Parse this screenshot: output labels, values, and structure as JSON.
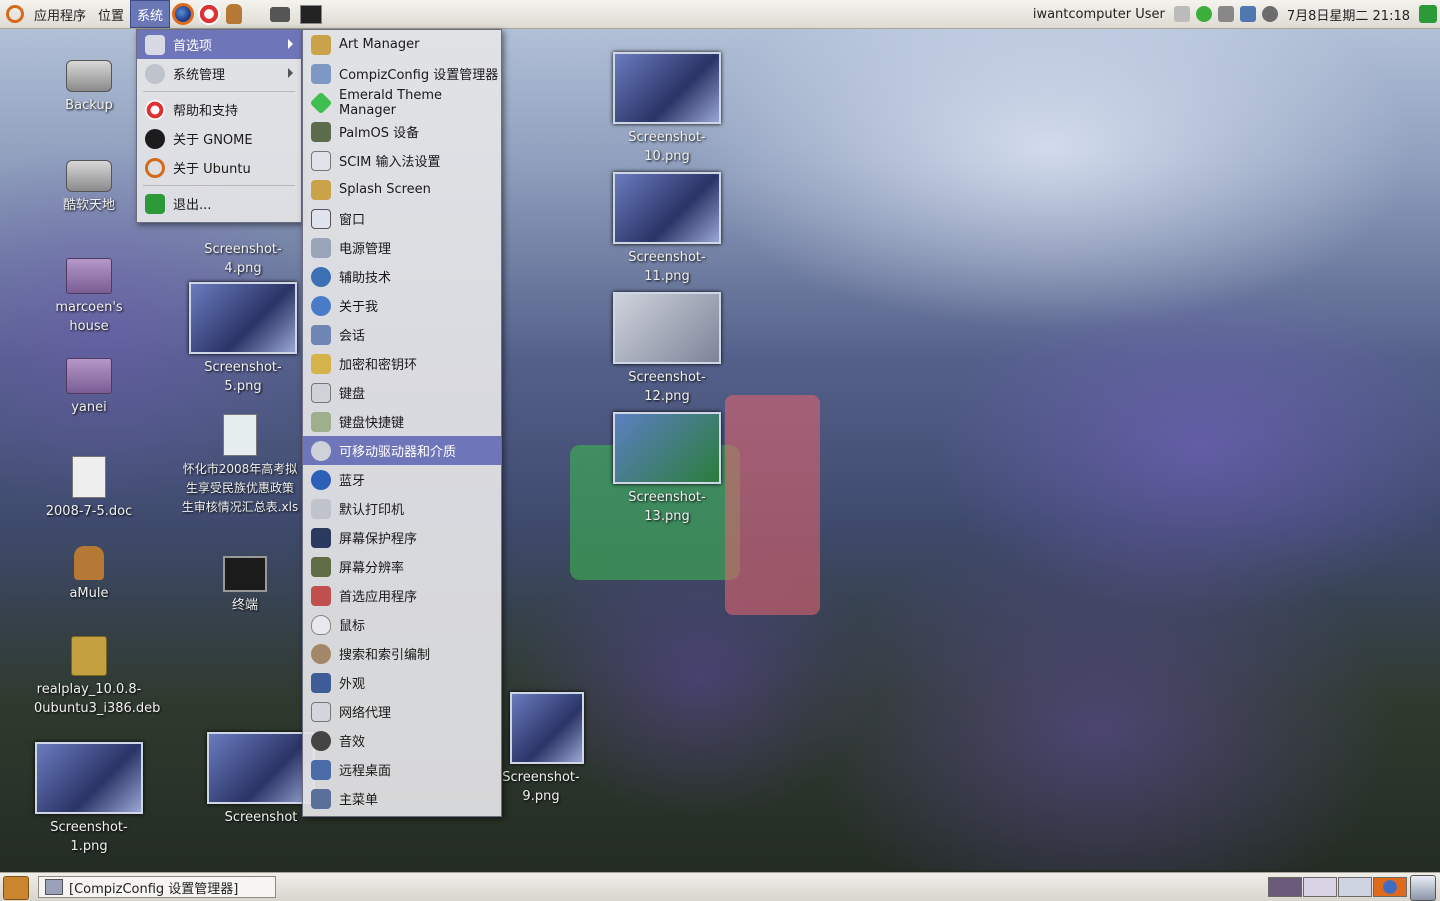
{
  "top_panel": {
    "applications": "应用程序",
    "places": "位置",
    "system": "系统",
    "user": "iwantcomputer User",
    "clock": "7月8日星期二 21:18"
  },
  "system_menu": {
    "items": [
      {
        "label": "首选项",
        "icon": "preferences-icon"
      },
      {
        "label": "系统管理",
        "icon": "administration-icon"
      },
      {
        "label": "帮助和支持",
        "icon": "help-icon"
      },
      {
        "label": "关于 GNOME",
        "icon": "gnome-foot-icon"
      },
      {
        "label": "关于 Ubuntu",
        "icon": "ubuntu-logo-icon"
      },
      {
        "label": "退出...",
        "icon": "quit-icon"
      }
    ]
  },
  "preferences_menu": {
    "items": [
      {
        "label": "Art Manager",
        "icon": "art-manager-icon"
      },
      {
        "label": "CompizConfig 设置管理器",
        "icon": "compizconfig-icon"
      },
      {
        "label": "Emerald Theme Manager",
        "icon": "emerald-icon"
      },
      {
        "label": "PalmOS 设备",
        "icon": "palm-icon"
      },
      {
        "label": "SCIM 输入法设置",
        "icon": "scim-icon"
      },
      {
        "label": "Splash Screen",
        "icon": "splash-icon"
      },
      {
        "label": "窗口",
        "icon": "window-icon"
      },
      {
        "label": "电源管理",
        "icon": "power-icon"
      },
      {
        "label": "辅助技术",
        "icon": "accessibility-icon"
      },
      {
        "label": "关于我",
        "icon": "about-me-icon"
      },
      {
        "label": "会话",
        "icon": "session-icon"
      },
      {
        "label": "加密和密钥环",
        "icon": "keyring-icon"
      },
      {
        "label": "键盘",
        "icon": "keyboard-icon"
      },
      {
        "label": "键盘快捷键",
        "icon": "shortcuts-icon"
      },
      {
        "label": "可移动驱动器和介质",
        "icon": "removable-media-icon"
      },
      {
        "label": "蓝牙",
        "icon": "bluetooth-icon"
      },
      {
        "label": "默认打印机",
        "icon": "printer-icon"
      },
      {
        "label": "屏幕保护程序",
        "icon": "screensaver-icon"
      },
      {
        "label": "屏幕分辨率",
        "icon": "resolution-icon"
      },
      {
        "label": "首选应用程序",
        "icon": "preferred-apps-icon"
      },
      {
        "label": "鼠标",
        "icon": "mouse-icon"
      },
      {
        "label": "搜索和索引编制",
        "icon": "search-icon"
      },
      {
        "label": "外观",
        "icon": "appearance-icon"
      },
      {
        "label": "网络代理",
        "icon": "proxy-icon"
      },
      {
        "label": "音效",
        "icon": "sound-icon"
      },
      {
        "label": "远程桌面",
        "icon": "remote-desktop-icon"
      },
      {
        "label": "主菜单",
        "icon": "main-menu-icon"
      }
    ]
  },
  "desktop_icons": {
    "backup": "Backup",
    "kuruan": "酷软天地",
    "marcoen": "marcoen's house",
    "yanei": "yanei",
    "doc": "2008-7-5.doc",
    "amule": "aMule",
    "realplay1": "realplay_10.0.8-",
    "realplay2": "0ubuntu3_i386.deb",
    "shot1": "Screenshot-1.png",
    "shot4": "Screenshot-4.png",
    "shot5": "Screenshot-5.png",
    "xls1": "怀化市2008年高考拟",
    "xls2": "生享受民族优惠政策",
    "xls3": "生审核情况汇总表.xls",
    "terminal": "终端",
    "shot_partial": "Screenshot",
    "shot10": "Screenshot-10.png",
    "shot11": "Screenshot-11.png",
    "shot12": "Screenshot-12.png",
    "shot13": "Screenshot-13.png",
    "shot9": "Screenshot-9.png"
  },
  "taskbar": {
    "window_title": "[CompizConfig 设置管理器]"
  },
  "colors": {
    "menu_highlight": "#6f75b9",
    "panel": "#e8e6e0"
  }
}
